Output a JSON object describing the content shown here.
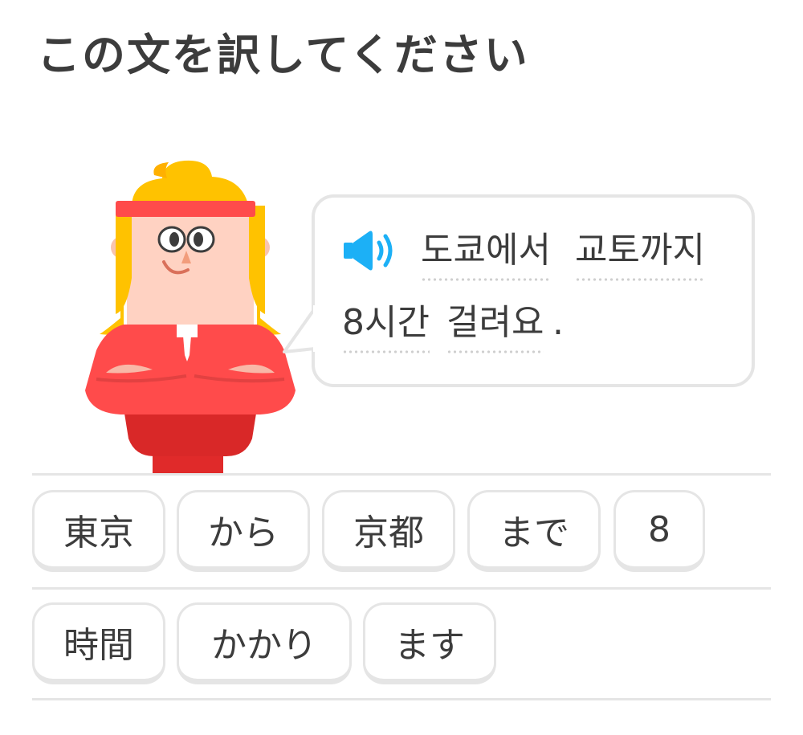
{
  "header": {
    "title": "この文を訳してください"
  },
  "prompt": {
    "words": [
      "도쿄에서",
      "교토까지",
      "8시간",
      "걸려요"
    ],
    "period": "."
  },
  "word_bank": {
    "row1": [
      "東京",
      "から",
      "京都",
      "まで",
      "8"
    ],
    "row2": [
      "時間",
      "かかり",
      "ます"
    ]
  },
  "colors": {
    "accent_blue": "#1cb0f6",
    "character_red": "#ff4b4b",
    "hair_yellow": "#ffc200",
    "border_gray": "#e5e5e5"
  },
  "icons": {
    "speaker": "speaker-icon"
  }
}
